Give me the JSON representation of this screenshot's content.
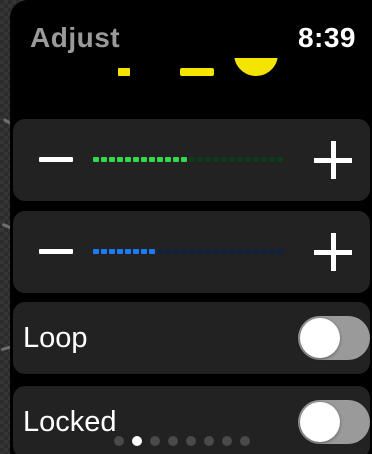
{
  "app": {
    "title": "Adjust",
    "time": "8:39"
  },
  "colors": {
    "slider1_fill": "#32d74b",
    "slider1_track": "#0f3b1c",
    "slider2_fill": "#1a7bff",
    "slider2_track": "#0f2240",
    "accent_yellow": "#f5e300"
  },
  "sliders": [
    {
      "minus_icon": "minus-icon",
      "plus_icon": "plus-icon",
      "level": 0.5
    },
    {
      "minus_icon": "minus-icon",
      "plus_icon": "plus-icon",
      "level": 0.333
    }
  ],
  "toggles": [
    {
      "label": "Loop",
      "on": false
    },
    {
      "label": "Locked",
      "on": false
    }
  ],
  "pagination": {
    "count": 8,
    "active": 1
  }
}
